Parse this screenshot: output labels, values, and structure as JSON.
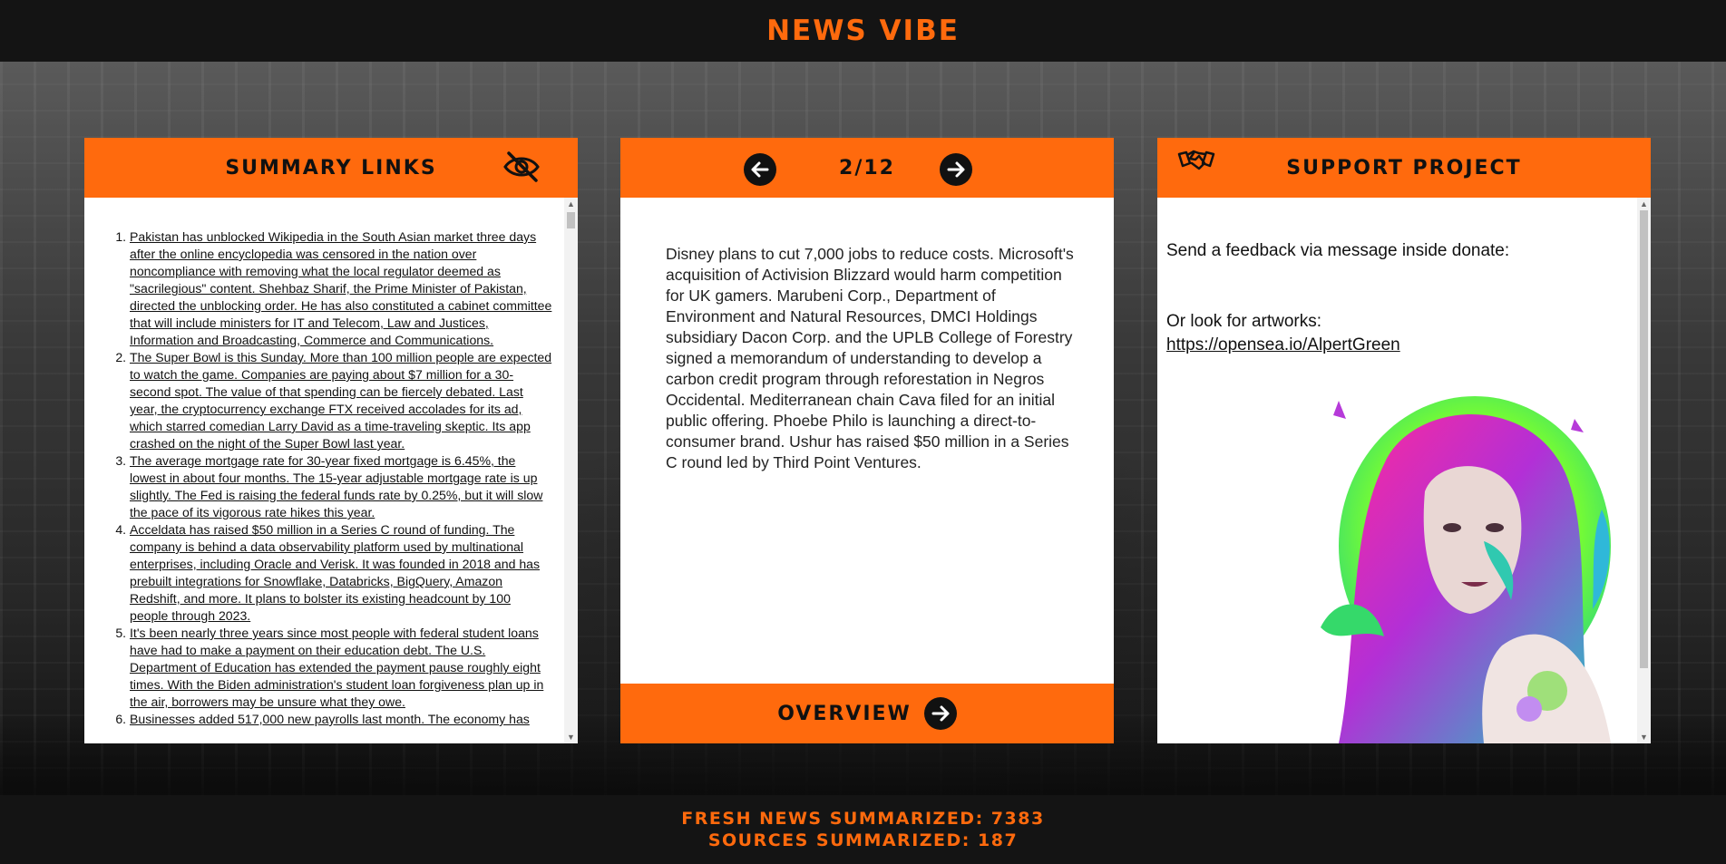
{
  "header": {
    "brand": "News Vibe"
  },
  "summary_panel": {
    "title": "Summary Links",
    "toggle_icon": "eye-off-icon",
    "items": [
      "Pakistan has unblocked Wikipedia in the South Asian market three days after the online encyclopedia was censored in the nation over noncompliance with removing what the local regulator deemed as \"sacrilegious\" content. Shehbaz Sharif, the Prime Minister of Pakistan, directed the unblocking order. He has also constituted a cabinet committee that will include ministers for IT and Telecom, Law and Justices, Information and Broadcasting, Commerce and Communications.",
      "The Super Bowl is this Sunday. More than 100 million people are expected to watch the game. Companies are paying about $7 million for a 30-second spot. The value of that spending can be fiercely debated. Last year, the cryptocurrency exchange FTX received accolades for its ad, which starred comedian Larry David as a time-traveling skeptic. Its app crashed on the night of the Super Bowl last year.",
      "The average mortgage rate for 30-year fixed mortgage is 6.45%, the lowest in about four months. The 15-year adjustable mortgage rate is up slightly. The Fed is raising the federal funds rate by 0.25%, but it will slow the pace of its vigorous rate hikes this year.",
      "Acceldata has raised $50 million in a Series C round of funding. The company is behind a data observability platform used by multinational enterprises, including Oracle and Verisk. It was founded in 2018 and has prebuilt integrations for Snowflake, Databricks, BigQuery, Amazon Redshift, and more. It plans to bolster its existing headcount by 100 people through 2023.",
      "It's been nearly three years since most people with federal student loans have had to make a payment on their education debt. The U.S. Department of Education has extended the payment pause roughly eight times. With the Biden administration's student loan forgiveness plan up in the air, borrowers may be unsure what they owe.",
      "Businesses added 517,000 new payrolls last month. The economy has"
    ]
  },
  "story_panel": {
    "counter": "2/12",
    "prev_icon": "arrow-left-icon",
    "next_icon": "arrow-right-icon",
    "text": "Disney plans to cut 7,000 jobs to reduce costs. Microsoft's acquisition of Activision Blizzard would harm competition for UK gamers. Marubeni Corp., Department of Environment and Natural Resources, DMCI Holdings subsidiary Dacon Corp. and the UPLB College of Forestry signed a memorandum of understanding to develop a carbon credit program through reforestation in Negros Occidental. Mediterranean chain Cava filed for an initial public offering. Phoebe Philo is launching a direct-to-consumer brand. Ushur has raised $50 million in a Series C round led by Third Point Ventures.",
    "overview_label": "Overview"
  },
  "support_panel": {
    "title": "Support Project",
    "icon": "handshake-icon",
    "line1": "Send a feedback via message inside donate:",
    "line2": "Or look for artworks:",
    "link": "https://opensea.io/AlpertGreen"
  },
  "footer": {
    "fresh_news": "Fresh news summarized: 7383",
    "sources": "Sources summarized: 187"
  },
  "colors": {
    "accent": "#ff6a0d",
    "dark": "#141414"
  }
}
